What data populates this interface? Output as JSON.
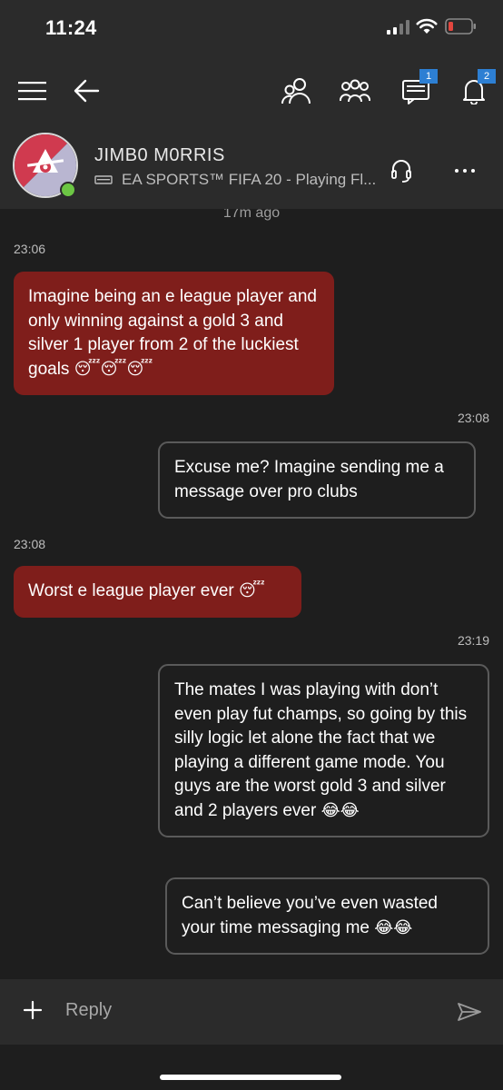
{
  "status_bar": {
    "time": "11:24",
    "icons": [
      "signal-icon",
      "wifi-icon",
      "battery-low-icon"
    ],
    "battery_color": "#e2463e"
  },
  "nav": {
    "icons": [
      "menu-icon",
      "back-arrow-icon",
      "friends-icon",
      "party-icon",
      "chat-icon",
      "notifications-icon"
    ],
    "chat_badge": "1",
    "notifications_badge": "2",
    "badge_color": "#2d7fd3"
  },
  "profile": {
    "gamertag": "JIMB0 M0RRIS",
    "status": "EA SPORTS™ FIFA 20 - Playing Fl...",
    "presence_color": "#6cc644"
  },
  "conversation": {
    "time_ago": "17m ago",
    "messages": [
      {
        "time": "23:06",
        "direction": "incoming",
        "text": "Imagine being an e league player and only winning against a gold 3 and silver 1 player from 2 of the luckiest goals",
        "emoji": "😴😴😴"
      },
      {
        "time": "23:08",
        "direction": "outgoing",
        "text": "Excuse me? Imagine sending me a message over pro clubs",
        "emoji": ""
      },
      {
        "time": "23:08",
        "direction": "incoming",
        "text": "Worst e league player ever",
        "emoji": "😴"
      },
      {
        "time": "23:19",
        "direction": "outgoing",
        "text": "The mates I was playing with don’t even play fut champs, so going by this silly logic  let alone the fact that we playing a different game mode. You guys are the worst gold 3 and silver and 2 players ever",
        "emoji": "😂😂"
      },
      {
        "time": "",
        "direction": "outgoing",
        "text": "Can’t believe you’ve even wasted your time messaging me",
        "emoji": "😂😂"
      }
    ],
    "incoming_color": "#7f1e1b",
    "outgoing_border_color": "#5a5a5a"
  },
  "composer": {
    "placeholder": "Reply",
    "icons": [
      "plus-icon",
      "send-icon"
    ]
  }
}
